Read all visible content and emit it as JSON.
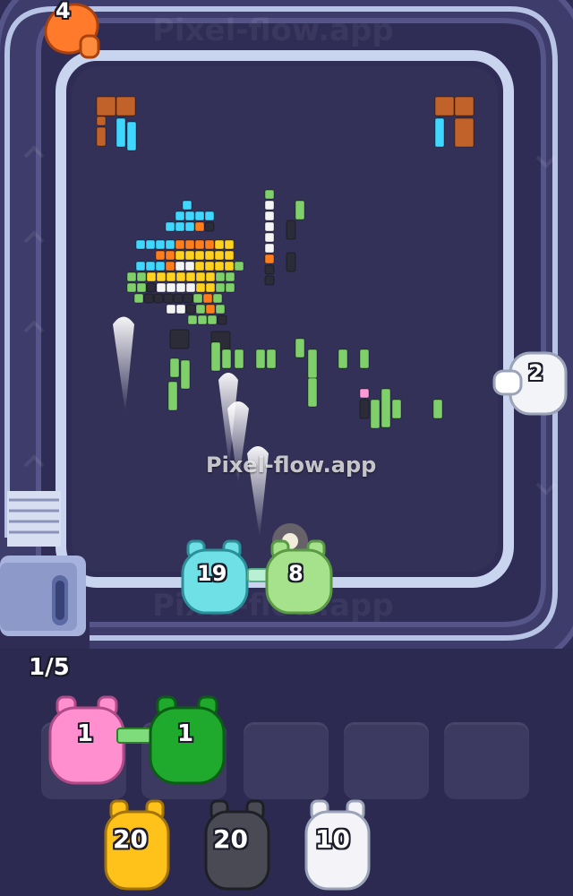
{
  "watermark": "Pixel-flow.app",
  "hud": {
    "progress_text": "1/5"
  },
  "track_shooters": [
    {
      "id": "cyan",
      "count": "19",
      "color": "#6fe0e6"
    },
    {
      "id": "lightgreen",
      "count": "8",
      "color": "#a6e28c"
    }
  ],
  "edge_shooters": [
    {
      "id": "orange",
      "count": "4",
      "color": "#ff7a2a"
    },
    {
      "id": "white",
      "count": "2",
      "color": "#f2f4f8"
    }
  ],
  "queue_shooters": [
    {
      "id": "pink",
      "count": "1",
      "color": "#ff8fcf"
    },
    {
      "id": "green",
      "count": "1",
      "color": "#1faa2e"
    }
  ],
  "reserve_shooters": [
    {
      "id": "yellow",
      "count": "20",
      "color": "#ffc21a"
    },
    {
      "id": "dark",
      "count": "20",
      "color": "#4a4a55"
    },
    {
      "id": "white2",
      "count": "10",
      "color": "#f4f4f8"
    }
  ],
  "empty_slots": 3,
  "pixel_colors": {
    "cyan": "#3fd6ff",
    "orange": "#ff7d1a",
    "yellow": "#ffd21f",
    "white": "#f4f4f4",
    "green": "#7fcf6a",
    "dark": "#2b2c38",
    "brown": "#c0622a",
    "pink": "#ff9ad6"
  }
}
